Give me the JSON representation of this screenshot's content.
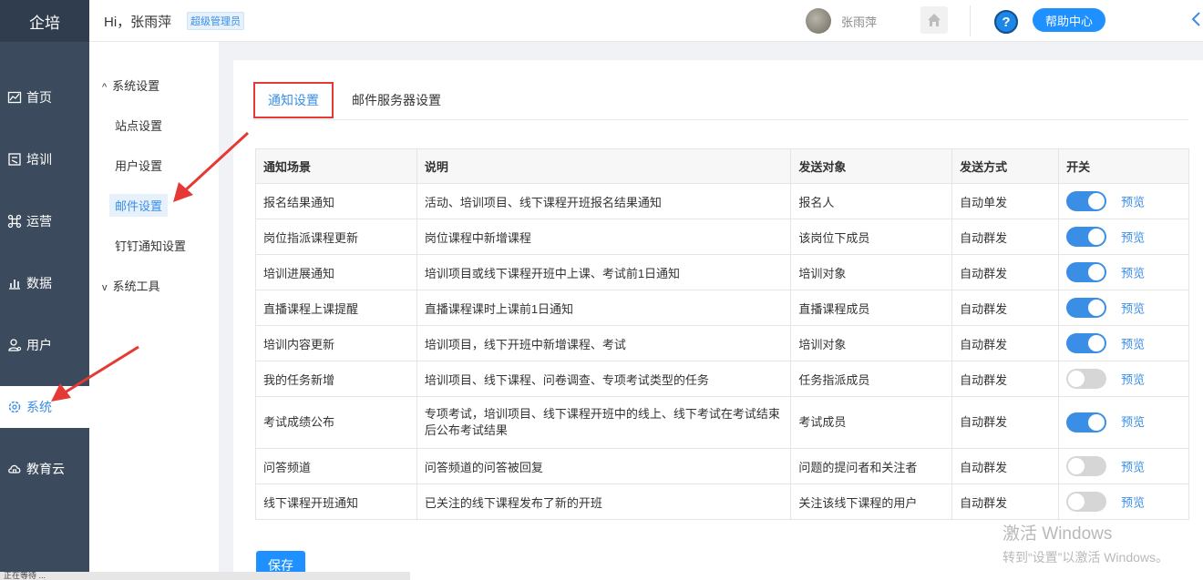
{
  "brand": "企培",
  "nav": [
    {
      "label": "首页",
      "icon": "chart-icon"
    },
    {
      "label": "培训",
      "icon": "book-icon"
    },
    {
      "label": "运营",
      "icon": "command-icon"
    },
    {
      "label": "数据",
      "icon": "bar-chart-icon"
    },
    {
      "label": "用户",
      "icon": "user-icon"
    },
    {
      "label": "系统",
      "icon": "gear-icon"
    },
    {
      "label": "教育云",
      "icon": "cloud-icon"
    }
  ],
  "header": {
    "greeting": "Hi，张雨萍",
    "role": "超级管理员",
    "username": "张雨萍",
    "help_label": "帮助中心",
    "help_q": "?"
  },
  "subnav": {
    "group1": "系统设置",
    "items": [
      "站点设置",
      "用户设置",
      "邮件设置",
      "钉钉通知设置"
    ],
    "group2": "系统工具",
    "caret_open": "^",
    "caret_closed": "v"
  },
  "tabs": [
    "通知设置",
    "邮件服务器设置"
  ],
  "table": {
    "headers": [
      "通知场景",
      "说明",
      "发送对象",
      "发送方式",
      "开关"
    ],
    "rows": [
      {
        "scene": "报名结果通知",
        "desc": "活动、培训项目、线下课程开班报名结果通知",
        "target": "报名人",
        "method": "自动单发",
        "on": true
      },
      {
        "scene": "岗位指派课程更新",
        "desc": "岗位课程中新增课程",
        "target": "该岗位下成员",
        "method": "自动群发",
        "on": true
      },
      {
        "scene": "培训进展通知",
        "desc": "培训项目或线下课程开班中上课、考试前1日通知",
        "target": "培训对象",
        "method": "自动群发",
        "on": true
      },
      {
        "scene": "直播课程上课提醒",
        "desc": "直播课程课时上课前1日通知",
        "target": "直播课程成员",
        "method": "自动群发",
        "on": true
      },
      {
        "scene": "培训内容更新",
        "desc": "培训项目，线下开班中新增课程、考试",
        "target": "培训对象",
        "method": "自动群发",
        "on": true
      },
      {
        "scene": "我的任务新增",
        "desc": "培训项目、线下课程、问卷调查、专项考试类型的任务",
        "target": "任务指派成员",
        "method": "自动群发",
        "on": false
      },
      {
        "scene": "考试成绩公布",
        "desc": "专项考试，培训项目、线下课程开班中的线上、线下考试在考试结束后公布考试结果",
        "target": "考试成员",
        "method": "自动群发",
        "on": true
      },
      {
        "scene": "问答频道",
        "desc": "问答频道的问答被回复",
        "target": "问题的提问者和关注者",
        "method": "自动群发",
        "on": false
      },
      {
        "scene": "线下课程开班通知",
        "desc": "已关注的线下课程发布了新的开班",
        "target": "关注该线下课程的用户",
        "method": "自动群发",
        "on": false
      }
    ],
    "preview_label": "预览"
  },
  "save_label": "保存",
  "watermark": {
    "line1": "激活 Windows",
    "line2": "转到“设置”以激活 Windows。"
  },
  "statusbar": "正在等待 ..."
}
